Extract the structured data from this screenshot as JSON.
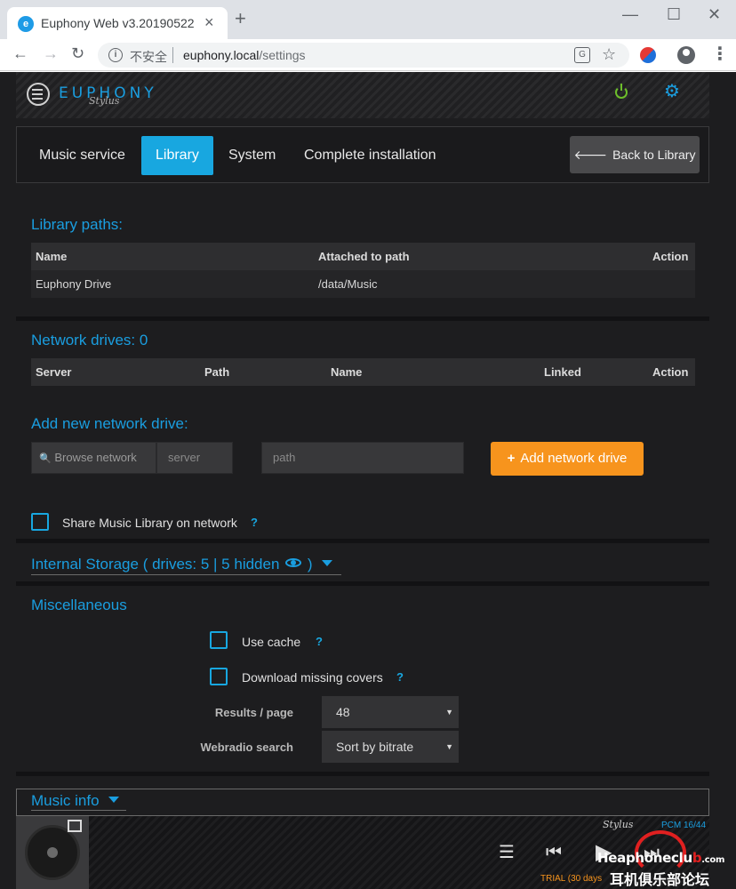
{
  "browser": {
    "tab_title": "Euphony Web v3.20190522",
    "tab_favicon": "e",
    "tab_close": "×",
    "new_tab": "+",
    "win_minimize": "—",
    "win_maximize": "☐",
    "win_close": "✕",
    "back": "←",
    "forward": "→",
    "reload": "↻",
    "info_glyph": "i",
    "insecure_label": "不安全",
    "url_host": "euphony.local",
    "url_path": "/settings",
    "translate_glyph": "G",
    "star_glyph": "☆",
    "menu_glyph": "⋮"
  },
  "app": {
    "logo_text": "EUPHONY",
    "logo_sub": "Stylus",
    "power_color": "#6dbf2b",
    "accent_color": "#18a7e0",
    "orange_color": "#f7941d",
    "gear_glyph": "⚙"
  },
  "tabs": {
    "items": [
      "Music service",
      "Library",
      "System",
      "Complete installation"
    ],
    "active": "Library",
    "back_arrow": "🡐",
    "back_label": "Back to Library"
  },
  "library_paths": {
    "title": "Library paths:",
    "headers": [
      "Name",
      "Attached to path",
      "Action"
    ],
    "rows": [
      [
        "Euphony Drive",
        "/data/Music",
        ""
      ]
    ]
  },
  "network_drives": {
    "title": "Network drives: 0",
    "headers": [
      "Server",
      "Path",
      "Name",
      "Linked",
      "Action"
    ]
  },
  "add_network": {
    "title": "Add new network drive:",
    "browse_label": "Browse network",
    "search_glyph": "🔍",
    "server_placeholder": "server",
    "path_placeholder": "path",
    "add_plus": "+",
    "add_label": "Add network drive"
  },
  "share": {
    "label": "Share Music Library on network",
    "help": "?",
    "checked": false
  },
  "internal_storage": {
    "title_prefix": "Internal Storage ( drives: 5 | 5 hidden",
    "title_suffix": " )"
  },
  "misc": {
    "title": "Miscellaneous",
    "use_cache_label": "Use cache",
    "download_covers_label": "Download missing covers",
    "help": "?",
    "results_label": "Results / page",
    "results_value": "48",
    "webradio_label": "Webradio search",
    "webradio_value": "Sort by bitrate",
    "select_caret": "▼"
  },
  "music_info": {
    "title": "Music info"
  },
  "player": {
    "stylus": "Stylus",
    "format": "PCM 16/44",
    "trial": "TRIAL (30 days",
    "queue_glyph": "☰",
    "prev_glyph": "⏮",
    "play_glyph": "▶",
    "next_glyph": "⏭"
  },
  "watermark": {
    "part1": "Hea",
    "part2": "phoneclu",
    "part3": "b",
    "part4": ".com",
    "line2": "耳机俱乐部论坛"
  }
}
